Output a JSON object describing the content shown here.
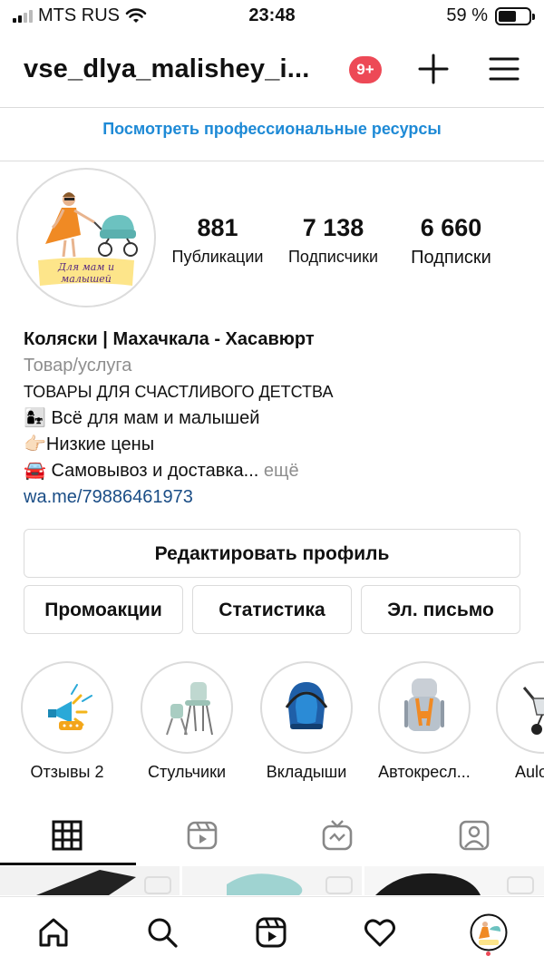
{
  "status_bar": {
    "carrier": "MTS RUS",
    "time": "23:48",
    "battery_percent": "59 %",
    "battery_level": 0.59,
    "signal_bars": 4,
    "signal_active": 2
  },
  "header": {
    "username": "vse_dlya_malishey_i...",
    "notification_badge": "9+",
    "plus_icon": "plus-icon",
    "menu_icon": "hamburger-menu-icon"
  },
  "pro_resources_link": "Посмотреть профессиональные ресурсы",
  "profile": {
    "avatar_caption_line1": "Для мам и",
    "avatar_caption_line2": "малышей",
    "stats": [
      {
        "number": "881",
        "label": "Публикации"
      },
      {
        "number": "7 138",
        "label": "Подписчики"
      },
      {
        "number": "6 660",
        "label": "Подписки"
      }
    ],
    "name": "Коляски | Махачкала - Хасавюрт",
    "category": "Товар/услуга",
    "bio_line1": "ТОВАРЫ ДЛЯ СЧАСТЛИВОГО ДЕТСТВА",
    "bio_line2_emoji": "👩‍👧",
    "bio_line2": " Всё для мам и малышей",
    "bio_line3_emoji": "👉🏻",
    "bio_line3": "Низкие цены",
    "bio_line4_emoji": "🚘",
    "bio_line4": " Самовывоз и доставка...",
    "more": " ещё",
    "link": "wa.me/79886461973"
  },
  "buttons": {
    "edit_profile": "Редактировать профиль",
    "promotions": "Промоакции",
    "insights": "Статистика",
    "email": "Эл. письмо"
  },
  "highlights": [
    {
      "label": "Отзывы 2",
      "icon": "megaphone-icon"
    },
    {
      "label": "Стульчики",
      "icon": "high-chair-icon"
    },
    {
      "label": "Вкладыши",
      "icon": "infant-carrier-icon"
    },
    {
      "label": "Автокресл...",
      "icon": "car-seat-icon"
    },
    {
      "label": "Aulon с",
      "icon": "stroller-icon"
    }
  ],
  "tabs": [
    {
      "icon": "grid-icon",
      "active": true
    },
    {
      "icon": "reels-icon",
      "active": false
    },
    {
      "icon": "igtv-icon",
      "active": false
    },
    {
      "icon": "tagged-icon",
      "active": false
    }
  ],
  "bottom_nav": [
    {
      "icon": "home-icon"
    },
    {
      "icon": "search-icon"
    },
    {
      "icon": "reels-icon"
    },
    {
      "icon": "heart-icon"
    },
    {
      "icon": "profile-avatar-icon"
    }
  ],
  "colors": {
    "badge": "#ed4956",
    "link_blue": "#1e8ad6",
    "bio_link": "#1a4d86",
    "muted": "#8e8e8e",
    "border": "#dbdbdb"
  }
}
